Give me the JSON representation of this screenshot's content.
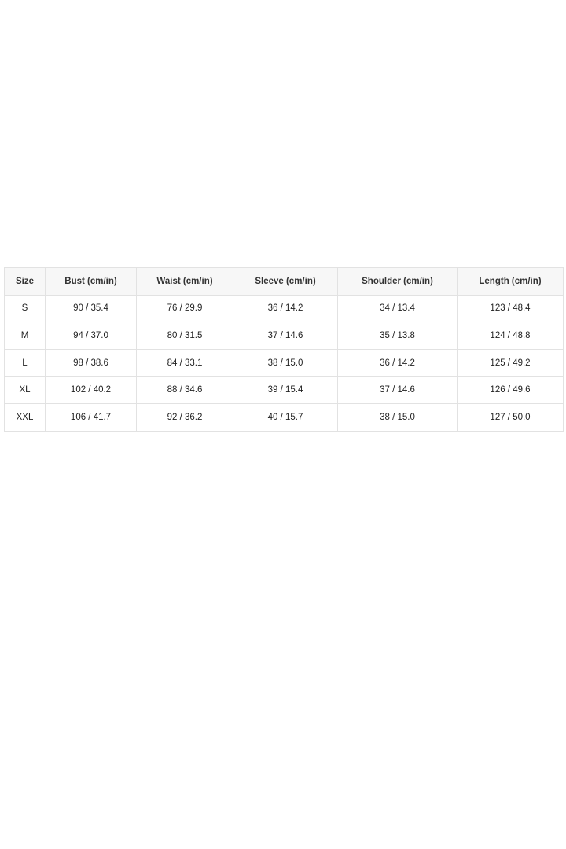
{
  "table": {
    "headers": [
      "Size",
      "Bust (cm/in)",
      "Waist (cm/in)",
      "Sleeve (cm/in)",
      "Shoulder (cm/in)",
      "Length (cm/in)"
    ],
    "rows": [
      [
        "S",
        "90 / 35.4",
        "76 / 29.9",
        "36 / 14.2",
        "34 / 13.4",
        "123 / 48.4"
      ],
      [
        "M",
        "94 / 37.0",
        "80 / 31.5",
        "37 / 14.6",
        "35 / 13.8",
        "124 / 48.8"
      ],
      [
        "L",
        "98 / 38.6",
        "84 / 33.1",
        "38 / 15.0",
        "36 / 14.2",
        "125 / 49.2"
      ],
      [
        "XL",
        "102 / 40.2",
        "88 / 34.6",
        "39 / 15.4",
        "37 / 14.6",
        "126 / 49.6"
      ],
      [
        "XXL",
        "106 / 41.7",
        "92 / 36.2",
        "40 / 15.7",
        "38 / 15.0",
        "127 / 50.0"
      ]
    ]
  }
}
